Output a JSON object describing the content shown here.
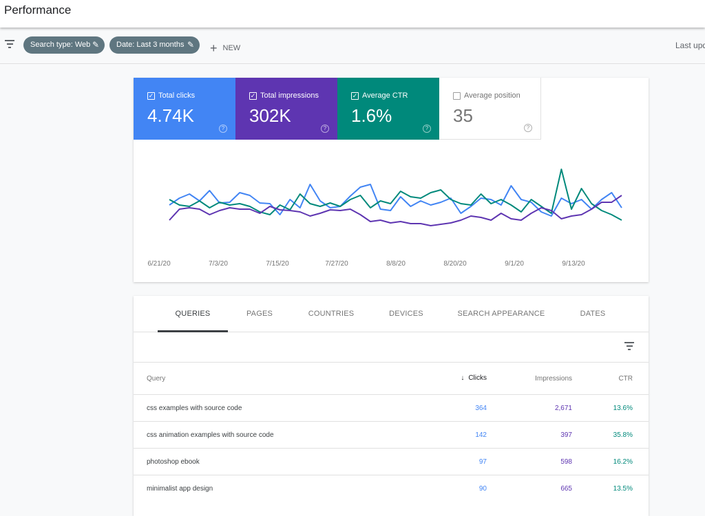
{
  "header": {
    "title": "Performance"
  },
  "filters": {
    "chips": [
      "Search type: Web",
      "Date: Last 3 months"
    ],
    "new_label": "NEW",
    "last_updated": "Last upd"
  },
  "metrics": [
    {
      "label": "Total clicks",
      "value": "4.74K",
      "checked": true,
      "color": "#4285f4"
    },
    {
      "label": "Total impressions",
      "value": "302K",
      "checked": true,
      "color": "#5e35b1"
    },
    {
      "label": "Average CTR",
      "value": "1.6%",
      "checked": true,
      "color": "#00897b"
    },
    {
      "label": "Average position",
      "value": "35",
      "checked": false,
      "color": "#ffffff"
    }
  ],
  "chart_data": {
    "type": "line",
    "yaxis_visible": false,
    "grid": false,
    "x_tick_labels": [
      "6/21/20",
      "7/3/20",
      "7/15/20",
      "7/27/20",
      "8/8/20",
      "8/20/20",
      "9/1/20",
      "9/13/20"
    ],
    "series": [
      {
        "name": "Total clicks",
        "color": "#4285f4",
        "values": [
          42,
          52,
          58,
          48,
          63,
          45,
          46,
          60,
          56,
          45,
          44,
          28,
          50,
          38,
          72,
          48,
          38,
          40,
          55,
          68,
          72,
          36,
          34,
          54,
          40,
          48,
          42,
          46,
          52,
          30,
          40,
          52,
          50,
          42,
          70,
          50,
          46,
          32,
          26,
          52,
          44,
          50,
          36,
          50,
          60,
          38
        ]
      },
      {
        "name": "Average CTR",
        "color": "#00897b",
        "values": [
          50,
          42,
          40,
          48,
          38,
          46,
          42,
          44,
          40,
          32,
          28,
          42,
          35,
          58,
          44,
          40,
          45,
          40,
          50,
          56,
          38,
          48,
          44,
          62,
          54,
          52,
          60,
          64,
          50,
          44,
          42,
          58,
          44,
          50,
          42,
          32,
          50,
          40,
          30,
          94,
          36,
          66,
          44,
          34,
          28,
          20
        ]
      },
      {
        "name": "Total impressions",
        "color": "#5e35b1",
        "values": [
          20,
          36,
          38,
          36,
          28,
          34,
          38,
          36,
          36,
          30,
          40,
          35,
          34,
          32,
          26,
          30,
          35,
          34,
          36,
          28,
          18,
          20,
          16,
          18,
          15,
          15,
          12,
          14,
          16,
          20,
          26,
          24,
          20,
          30,
          22,
          20,
          30,
          38,
          34,
          22,
          26,
          28,
          36,
          46,
          46,
          56
        ]
      }
    ]
  },
  "tabs": [
    "QUERIES",
    "PAGES",
    "COUNTRIES",
    "DEVICES",
    "SEARCH APPEARANCE",
    "DATES"
  ],
  "table": {
    "headers": [
      "Query",
      "Clicks",
      "Impressions",
      "CTR"
    ],
    "rows": [
      [
        "css examples with source code",
        "364",
        "2,671",
        "13.6%"
      ],
      [
        "css animation examples with source code",
        "142",
        "397",
        "35.8%"
      ],
      [
        "photoshop ebook",
        "97",
        "598",
        "16.2%"
      ],
      [
        "minimalist app design",
        "90",
        "665",
        "13.5%"
      ]
    ]
  }
}
